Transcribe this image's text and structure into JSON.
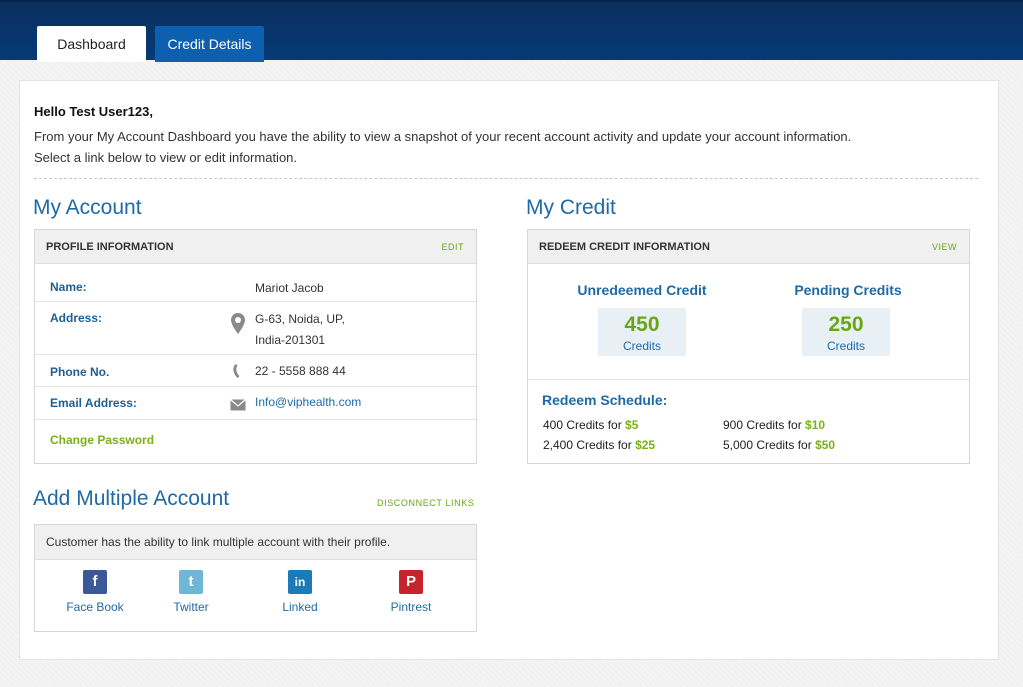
{
  "tabs": [
    {
      "label": "Dashboard",
      "active": true
    },
    {
      "label": "Credit Details",
      "active": false
    }
  ],
  "greeting": "Hello Test User123,",
  "intro_line1": "From your My Account Dashboard you have the ability to view a snapshot of your recent account activity and update your account information.",
  "intro_line2": "Select a link below to view or edit information.",
  "my_account": {
    "title": "My Account",
    "panel_title": "PROFILE INFORMATION",
    "edit_label": "EDIT",
    "name_label": "Name:",
    "name_value": "Mariot Jacob",
    "address_label": "Address:",
    "address_line1": "G-63, Noida, UP,",
    "address_line2": "India-201301",
    "phone_label": "Phone No.",
    "phone_value": "22 - 5558 888 44",
    "email_label": "Email Address:",
    "email_value": "Info@viphealth.com",
    "change_password": "Change Password"
  },
  "my_credit": {
    "title": "My Credit",
    "panel_title": "REDEEM CREDIT INFORMATION",
    "view_label": "VIEW",
    "unredeemed_title": "Unredeemed Credit",
    "unredeemed_value": "450",
    "pending_title": "Pending Credits",
    "pending_value": "250",
    "unit": "Credits",
    "schedule_title": "Redeem Schedule:",
    "schedule": [
      {
        "credits": "400 Credits for",
        "amount": "$5"
      },
      {
        "credits": "900 Credits for",
        "amount": "$10"
      },
      {
        "credits": "2,400 Credits for",
        "amount": "$25"
      },
      {
        "credits": "5,000 Credits for",
        "amount": "$50"
      }
    ]
  },
  "multi_account": {
    "title": "Add Multiple Account",
    "disconnect": "DISCONNECT LINKS",
    "note": "Customer has the ability to link multiple account with their profile.",
    "socials": [
      {
        "name": "Face Book",
        "icon": "facebook-icon",
        "glyph": "f",
        "color": "#3b5998"
      },
      {
        "name": "Twitter",
        "icon": "twitter-icon",
        "glyph": "t",
        "color": "#6fb7d6"
      },
      {
        "name": "Linked",
        "icon": "linkedin-icon",
        "glyph": "in",
        "color": "#1b7ab8"
      },
      {
        "name": "Pintrest",
        "icon": "pinterest-icon",
        "glyph": "P",
        "color": "#c8232c"
      }
    ]
  }
}
